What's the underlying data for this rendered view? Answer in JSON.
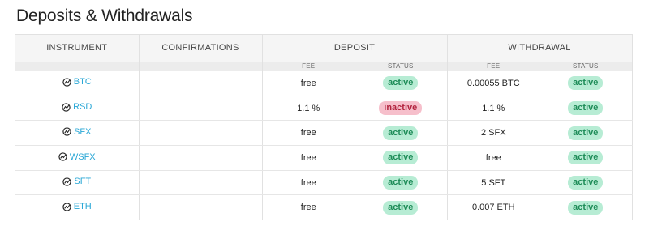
{
  "page_title": "Deposits & Withdrawals",
  "headers": {
    "instrument": "INSTRUMENT",
    "confirmations": "CONFIRMATIONS",
    "deposit": "DEPOSIT",
    "withdrawal": "WITHDRAWAL",
    "fee": "FEE",
    "status": "STATUS"
  },
  "rows": [
    {
      "instrument": "BTC",
      "confirmations": "",
      "deposit_fee": "free",
      "deposit_status": "active",
      "withdrawal_fee": "0.00055 BTC",
      "withdrawal_status": "active"
    },
    {
      "instrument": "RSD",
      "confirmations": "",
      "deposit_fee": "1.1 %",
      "deposit_status": "inactive",
      "withdrawal_fee": "1.1 %",
      "withdrawal_status": "active"
    },
    {
      "instrument": "SFX",
      "confirmations": "",
      "deposit_fee": "free",
      "deposit_status": "active",
      "withdrawal_fee": "2 SFX",
      "withdrawal_status": "active"
    },
    {
      "instrument": "WSFX",
      "confirmations": "",
      "deposit_fee": "free",
      "deposit_status": "active",
      "withdrawal_fee": "free",
      "withdrawal_status": "active"
    },
    {
      "instrument": "SFT",
      "confirmations": "",
      "deposit_fee": "free",
      "deposit_status": "active",
      "withdrawal_fee": "5 SFT",
      "withdrawal_status": "active"
    },
    {
      "instrument": "ETH",
      "confirmations": "",
      "deposit_fee": "free",
      "deposit_status": "active",
      "withdrawal_fee": "0.007 ETH",
      "withdrawal_status": "active"
    }
  ],
  "icons": {
    "instrument": "chart-trend-icon"
  },
  "colors": {
    "link": "#29a7d6",
    "active_bg": "#b7ecd4",
    "active_text": "#1e8c58",
    "inactive_bg": "#f6bfcb",
    "inactive_text": "#b2243f"
  }
}
